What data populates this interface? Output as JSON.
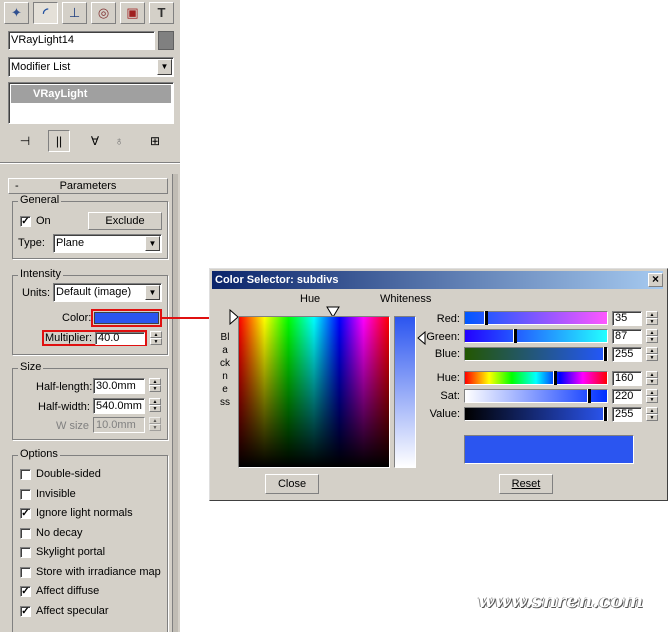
{
  "cmd_panel": {
    "tabs": [
      "create-icon",
      "modify-icon",
      "hierarchy-icon",
      "motion-icon",
      "display-icon",
      "utilities-icon"
    ],
    "object_name": "VRayLight14",
    "modifier_list": "Modifier List",
    "stack_item": "VRayLight"
  },
  "rollout": {
    "title": "Parameters",
    "collapse": "-",
    "general": {
      "label": "General",
      "on_label": "On",
      "on_checked": true,
      "exclude_label": "Exclude",
      "type_label": "Type:",
      "type_value": "Plane"
    },
    "intensity": {
      "label": "Intensity",
      "units_label": "Units:",
      "units_value": "Default (image)",
      "color_label": "Color:",
      "color_value": "#2b55f0",
      "multiplier_label": "Multiplier:",
      "multiplier_value": "40.0"
    },
    "size": {
      "label": "Size",
      "half_length_label": "Half-length:",
      "half_length_value": "30.0mm",
      "half_width_label": "Half-width:",
      "half_width_value": "540.0mm",
      "wsize_label": "W size",
      "wsize_value": "10.0mm"
    },
    "options": {
      "label": "Options",
      "items": [
        {
          "label": "Double-sided",
          "checked": false
        },
        {
          "label": "Invisible",
          "checked": false
        },
        {
          "label": "Ignore light normals",
          "checked": true
        },
        {
          "label": "No decay",
          "checked": false
        },
        {
          "label": "Skylight portal",
          "checked": false
        },
        {
          "label": "Store with irradiance map",
          "checked": false
        },
        {
          "label": "Affect diffuse",
          "checked": true
        },
        {
          "label": "Affect specular",
          "checked": true
        }
      ]
    }
  },
  "color_selector": {
    "title": "Color Selector: subdivs",
    "close_x": "×",
    "hue_label": "Hue",
    "whiteness_label": "Whiteness",
    "blackness_label": "Blackness",
    "red_label": "Red:",
    "red_value": "35",
    "green_label": "Green:",
    "green_value": "87",
    "blue_label": "Blue:",
    "blue_value": "255",
    "hue2_label": "Hue:",
    "hue_value": "160",
    "sat_label": "Sat:",
    "sat_value": "220",
    "val_label": "Value:",
    "val_value": "255",
    "swatch_color": "#2b55f0",
    "close_button": "Close",
    "reset_button": "Reset"
  },
  "watermark": "www.snren.com",
  "highlight_color": "#e01010"
}
